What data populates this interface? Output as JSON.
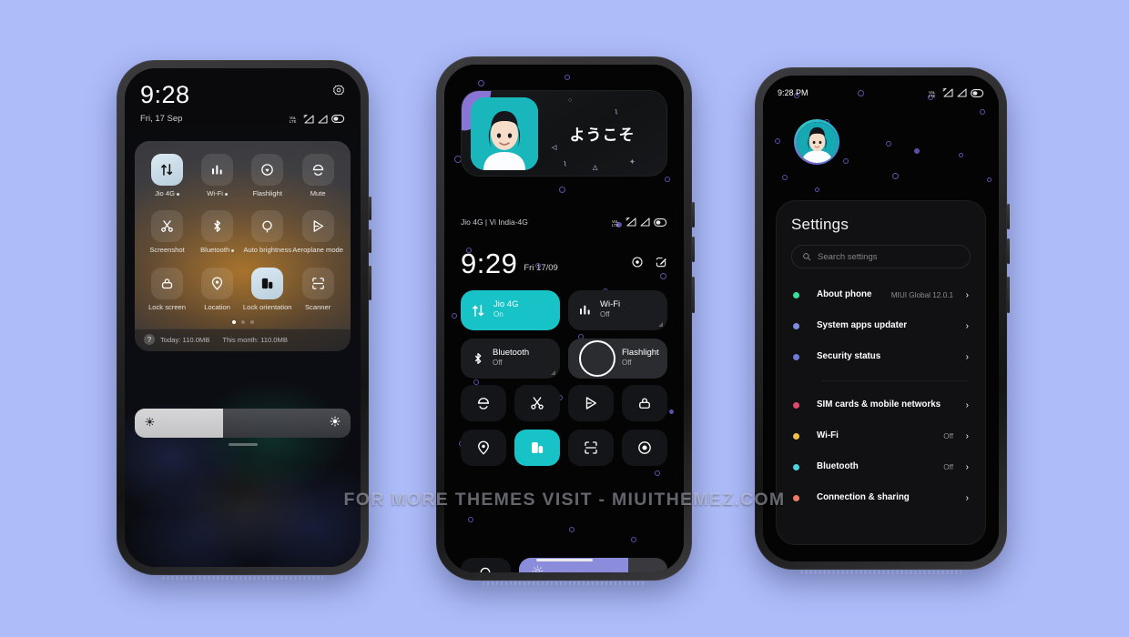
{
  "background_color": "#aebdfa",
  "watermark": "FOR MORE THEMES VISIT - MIUITHEMEZ.COM",
  "accent_colors": {
    "teal": "#18c3c8",
    "purple": "#6d5fc4",
    "amber": "#d68c28",
    "slider_purple": "#8b8ddc"
  },
  "phone1": {
    "name": "notification-shade",
    "clock": "9:28",
    "date": "Fri, 17 Sep",
    "gear_icon": "gear-icon",
    "status_icons": [
      "volte-icon",
      "signal-icon",
      "signal-icon",
      "battery-icon"
    ],
    "tiles": [
      {
        "label": "Jio 4G",
        "icon": "data-arrows-icon",
        "active": true,
        "dot": true
      },
      {
        "label": "Wi-Fi",
        "icon": "wifi-bars-icon",
        "active": false,
        "dot": true
      },
      {
        "label": "Flashlight",
        "icon": "flashlight-icon",
        "active": false,
        "dot": false
      },
      {
        "label": "Mute",
        "icon": "mute-bell-icon",
        "active": false,
        "dot": false
      },
      {
        "label": "Screenshot",
        "icon": "scissors-icon",
        "active": false,
        "dot": false
      },
      {
        "label": "Bluetooth",
        "icon": "bluetooth-icon",
        "active": false,
        "dot": true
      },
      {
        "label": "Auto brightness",
        "icon": "auto-brightness-icon",
        "active": false,
        "dot": false
      },
      {
        "label": "Aeroplane mode",
        "icon": "aeroplane-icon",
        "active": false,
        "dot": false
      },
      {
        "label": "Lock screen",
        "icon": "lock-icon",
        "active": false,
        "dot": false
      },
      {
        "label": "Location",
        "icon": "location-pin-icon",
        "active": false,
        "dot": false
      },
      {
        "label": "Lock orientation",
        "icon": "rotation-lock-icon",
        "active": true,
        "dot": false
      },
      {
        "label": "Scanner",
        "icon": "scanner-frame-icon",
        "active": false,
        "dot": false
      }
    ],
    "pager": {
      "pages": 3,
      "active": 1
    },
    "data_usage": {
      "help_icon": "question-mark-icon",
      "today": "Today: 110.0MB",
      "month": "This month: 110.0MB"
    },
    "brightness": {
      "level_percent": 41,
      "low_icon": "brightness-low-icon",
      "high_icon": "brightness-high-icon"
    }
  },
  "phone2": {
    "name": "control-center",
    "widget": {
      "greeting": "ようこそ",
      "avatar": "user-avatar"
    },
    "carrier": "Jio 4G | Vi India-4G",
    "status_icons": [
      "volte-icon",
      "signal-icon",
      "signal-icon",
      "battery-icon"
    ],
    "clock": "9:29",
    "date": "Fri 17/09",
    "clock_icons": [
      "power-icon",
      "edit-icon"
    ],
    "big_tiles": [
      {
        "label": "Jio 4G",
        "state": "On",
        "icon": "data-arrows-icon",
        "active": true,
        "corner": false
      },
      {
        "label": "Wi-Fi",
        "state": "Off",
        "icon": "wifi-bars-icon",
        "active": false,
        "corner": true
      },
      {
        "label": "Bluetooth",
        "state": "Off",
        "icon": "bluetooth-icon",
        "active": false,
        "corner": true
      },
      {
        "label": "Flashlight",
        "state": "Off",
        "icon": "flashlight-icon",
        "active": false,
        "corner": false,
        "pressed": true
      }
    ],
    "small_tiles": [
      {
        "icon": "mute-bell-icon",
        "active": false
      },
      {
        "icon": "scissors-icon",
        "active": false
      },
      {
        "icon": "aeroplane-icon",
        "active": false
      },
      {
        "icon": "lock-icon",
        "active": false
      },
      {
        "icon": "location-pin-icon",
        "active": false
      },
      {
        "icon": "rotation-lock-icon",
        "active": true
      },
      {
        "icon": "scanner-frame-icon",
        "active": false
      },
      {
        "icon": "dark-mode-icon",
        "active": false
      }
    ],
    "last_row": {
      "icon": "auto-brightness-icon",
      "brightness_percent": 74
    }
  },
  "phone3": {
    "name": "settings-screen",
    "status_time": "9:28 PM",
    "status_icons": [
      "volte-icon",
      "signal-icon",
      "signal-icon",
      "battery-icon"
    ],
    "avatar": "user-avatar",
    "title": "Settings",
    "search": {
      "placeholder": "Search settings",
      "icon": "search-icon"
    },
    "items": [
      {
        "label": "About phone",
        "value": "MIUI Global 12.0.1",
        "color": "#3ddc9a",
        "sep_after": false
      },
      {
        "label": "System apps updater",
        "value": "",
        "color": "#7d8ee0",
        "sep_after": false
      },
      {
        "label": "Security status",
        "value": "",
        "color": "#6e79d8",
        "sep_after": true
      },
      {
        "label": "SIM cards & mobile networks",
        "value": "",
        "color": "#e0496b",
        "sep_after": false
      },
      {
        "label": "Wi-Fi",
        "value": "Off",
        "color": "#f0c04a",
        "sep_after": false
      },
      {
        "label": "Bluetooth",
        "value": "Off",
        "color": "#4fd2e0",
        "sep_after": false
      },
      {
        "label": "Connection & sharing",
        "value": "",
        "color": "#ef7a66",
        "sep_after": false
      }
    ]
  }
}
